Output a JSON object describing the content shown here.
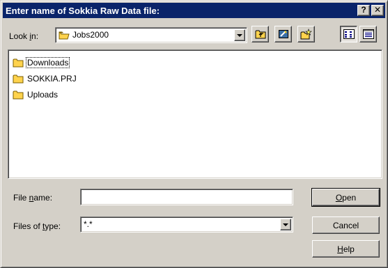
{
  "window": {
    "title": "Enter name of Sokkia Raw Data file:",
    "help_glyph": "?",
    "close_glyph": "✕"
  },
  "lookin": {
    "label_pre": "Look ",
    "label_u": "i",
    "label_post": "n:",
    "value": "Jobs2000",
    "icon": "folder-icon"
  },
  "toolbar": {
    "buttons": [
      "up-one-level",
      "desktop",
      "create-new-folder",
      "list-view",
      "details-view"
    ]
  },
  "files": [
    {
      "name": "Downloads",
      "icon": "folder-icon",
      "focused": true
    },
    {
      "name": "SOKKIA.PRJ",
      "icon": "folder-icon",
      "focused": false
    },
    {
      "name": "Uploads",
      "icon": "folder-icon",
      "focused": false
    }
  ],
  "filename": {
    "label_pre": "File ",
    "label_u": "n",
    "label_post": "ame:",
    "value": ""
  },
  "filetype": {
    "label_pre": "Files of ",
    "label_u": "t",
    "label_post": "ype:",
    "value": "*.*"
  },
  "buttons": {
    "open_u": "O",
    "open_rest": "pen",
    "cancel": "Cancel",
    "help_u": "H",
    "help_rest": "elp"
  },
  "colors": {
    "title_bar": "#0a246a",
    "face": "#d4d0c8",
    "folder": "#ffd34d"
  }
}
